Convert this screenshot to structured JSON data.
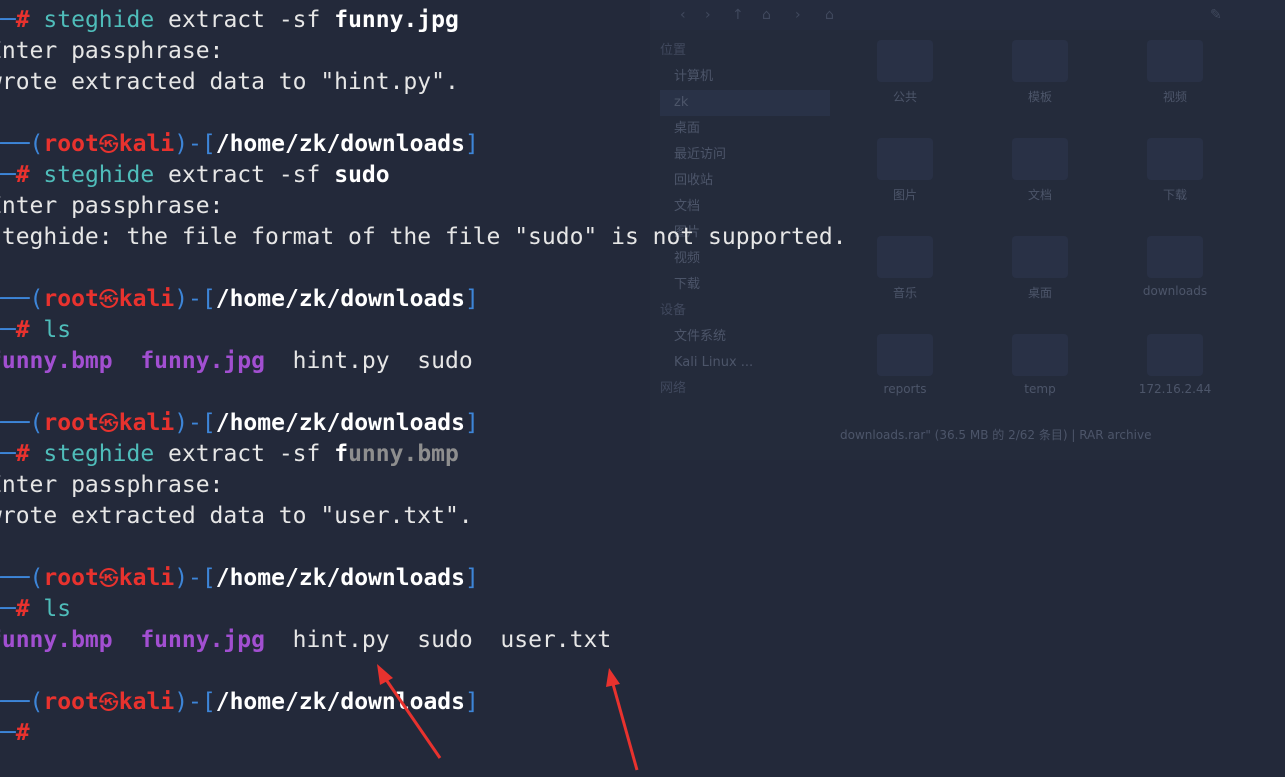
{
  "file_manager": {
    "sidebar": {
      "places_header": "位置",
      "items": [
        "计算机",
        "zk",
        "桌面",
        "最近访问",
        "回收站",
        "文档",
        "图片",
        "视频",
        "下载"
      ],
      "devices_header": "设备",
      "devices": [
        "文件系统",
        "Kali Linux ..."
      ],
      "network_header": "网络"
    },
    "folders": [
      "公共",
      "模板",
      "视频",
      "图片",
      "文档",
      "下载",
      "音乐",
      "桌面",
      "downloads",
      "reports",
      "temp",
      "172.16.2.44"
    ],
    "status": "downloads.rar\" (36.5 MB 的 2/62 条目) | RAR archive"
  },
  "terminal": {
    "prompt": {
      "bracket_open": "(",
      "user": "root",
      "skull": "㉿",
      "host": "kali",
      "bracket_mid": ")-[",
      "path": "/home/zk/downloads",
      "bracket_close": "]",
      "corner_top": "┌──",
      "corner_bottom": "└─",
      "hash": "#"
    },
    "blocks": [
      {
        "command": "steghide",
        "args": " extract -sf ",
        "target": "funny.jpg",
        "output": [
          "Enter passphrase:",
          "wrote extracted data to \"hint.py\"."
        ]
      },
      {
        "command": "steghide",
        "args": " extract -sf ",
        "target": "sudo",
        "output": [
          "Enter passphrase:",
          "steghide: the file format of the file \"sudo\" is not supported."
        ]
      },
      {
        "command": "ls",
        "listing": [
          "funny.bmp",
          "funny.jpg",
          "hint.py",
          "sudo"
        ]
      },
      {
        "command": "steghide",
        "args": " extract -sf ",
        "target_typed": "f",
        "target_suggest": "unny.bmp",
        "output": [
          "Enter passphrase:",
          "wrote extracted data to \"user.txt\"."
        ]
      },
      {
        "command": "ls",
        "listing": [
          "funny.bmp",
          "funny.jpg",
          "hint.py",
          "sudo",
          "user.txt"
        ]
      }
    ]
  },
  "colors": {
    "background": "#23293a",
    "prompt_bracket": "#3d85d8",
    "prompt_user": "#e8322e",
    "command": "#4fbdba",
    "image_file": "#a24fd1",
    "arrow": "#e8322e"
  }
}
